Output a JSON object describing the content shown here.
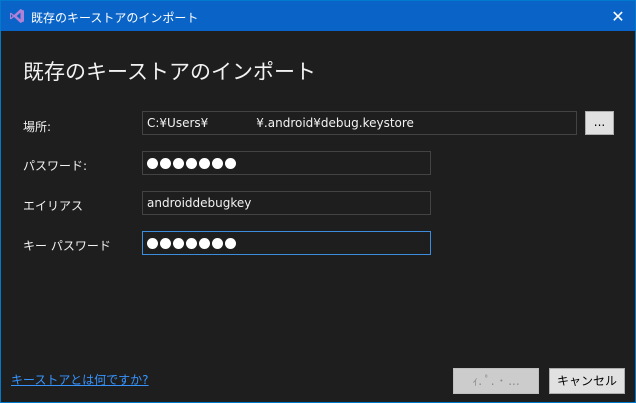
{
  "window": {
    "title": "既存のキーストアのインポート",
    "close_symbol": "✕"
  },
  "heading": "既存のキーストアのインポート",
  "form": {
    "location": {
      "label": "場所:",
      "value_prefix": "C:¥Users¥",
      "value_suffix": "¥.android¥debug.keystore",
      "browse_label": "..."
    },
    "password": {
      "label": "パスワード:",
      "dot_count": 7
    },
    "alias": {
      "label": "エイリアス",
      "value": "androiddebugkey"
    },
    "key_password": {
      "label": "キー パスワード",
      "dot_count": 7
    }
  },
  "footer": {
    "help_link": "キーストアとは何ですか?",
    "import_label": "ｨ. ﾟ. ･ ...",
    "cancel_label": "キャンセル"
  },
  "colors": {
    "titlebar": "#0a64c8",
    "background": "#1e1e1e",
    "accent_border": "#3c8ddb",
    "link": "#3794ff"
  }
}
